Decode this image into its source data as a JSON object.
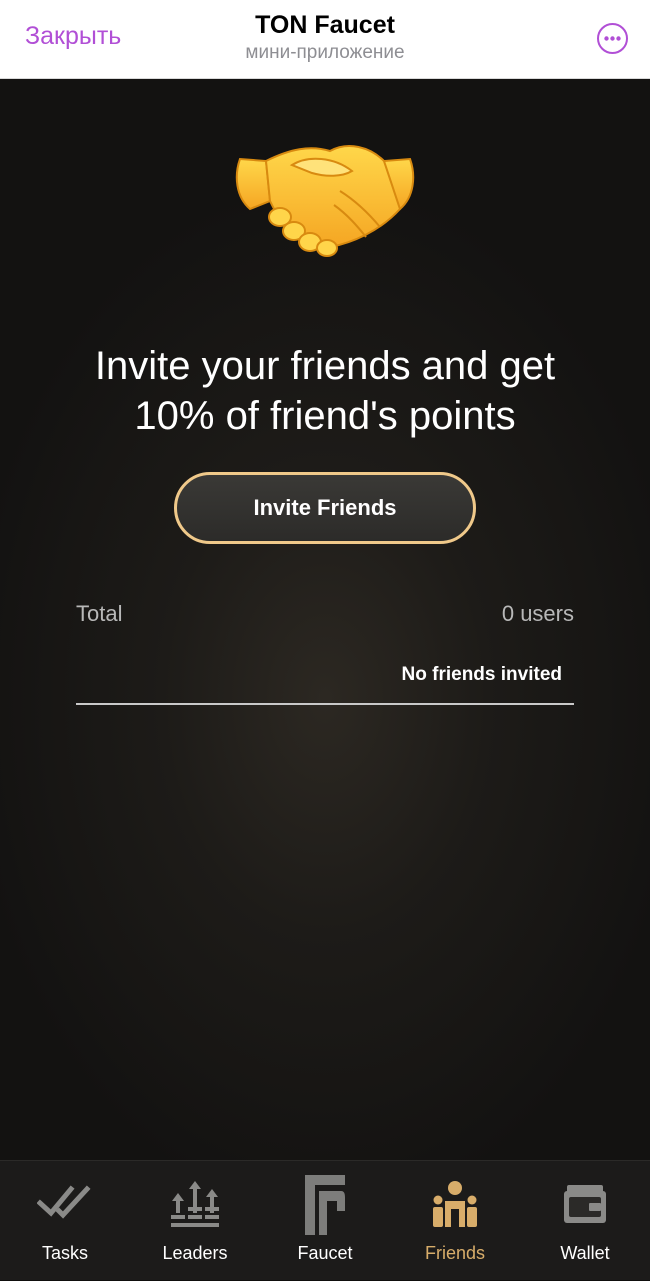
{
  "header": {
    "close_label": "Закрыть",
    "title": "TON Faucet",
    "subtitle": "мини-приложение",
    "more_icon": "more-horizontal-icon"
  },
  "main": {
    "hero_icon": "handshake-icon",
    "headline_line1": "Invite your friends and get",
    "headline_line2": "10% of friend's points",
    "invite_button": "Invite Friends",
    "total_label": "Total",
    "total_value": "0 users",
    "empty_message": "No friends invited"
  },
  "nav": {
    "items": [
      {
        "label": "Tasks",
        "icon": "double-check-icon",
        "active": false
      },
      {
        "label": "Leaders",
        "icon": "leaderboard-icon",
        "active": false
      },
      {
        "label": "Faucet",
        "icon": "faucet-icon",
        "active": false
      },
      {
        "label": "Friends",
        "icon": "friends-icon",
        "active": true
      },
      {
        "label": "Wallet",
        "icon": "wallet-icon",
        "active": false
      }
    ]
  },
  "colors": {
    "accent_header": "#b14fd6",
    "button_border": "#f0c98a",
    "nav_active": "#d8ad6a",
    "background": "#1d1b18"
  }
}
